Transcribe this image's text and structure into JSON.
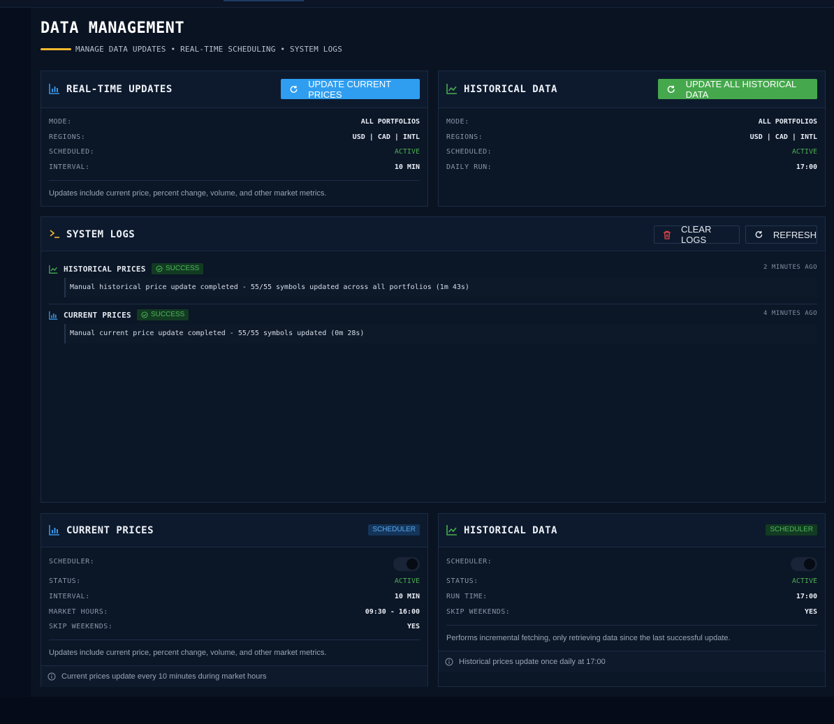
{
  "page": {
    "title": "DATA MANAGEMENT",
    "subtitle": "MANAGE DATA UPDATES • REAL-TIME SCHEDULING • SYSTEM LOGS"
  },
  "colors": {
    "accent_blue": "#2f9ef0",
    "accent_green": "#45a84c",
    "title_underline": "#f5b82e",
    "active_text": "#4caf50"
  },
  "realtime": {
    "title": "REAL-TIME UPDATES",
    "icon": "bar-chart-icon",
    "button_label": "UPDATE CURRENT PRICES",
    "rows": [
      {
        "key": "MODE:",
        "value": "ALL PORTFOLIOS"
      },
      {
        "key": "REGIONS:",
        "value": "USD | CAD | INTL"
      },
      {
        "key": "SCHEDULED:",
        "value": "ACTIVE"
      },
      {
        "key": "INTERVAL:",
        "value": "10 MIN"
      }
    ],
    "note": "Updates include current price, percent change, volume, and other market metrics."
  },
  "historical": {
    "title": "HISTORICAL DATA",
    "icon": "line-chart-icon",
    "button_label": "UPDATE ALL HISTORICAL DATA",
    "rows": [
      {
        "key": "MODE:",
        "value": "ALL PORTFOLIOS"
      },
      {
        "key": "REGIONS:",
        "value": "USD | CAD | INTL"
      },
      {
        "key": "SCHEDULED:",
        "value": "ACTIVE"
      },
      {
        "key": "DAILY RUN:",
        "value": "17:00"
      }
    ]
  },
  "logs": {
    "title": "SYSTEM LOGS",
    "icon": "terminal-icon",
    "clear_label": "CLEAR LOGS",
    "refresh_label": "REFRESH",
    "entries": [
      {
        "title": "HISTORICAL PRICES",
        "status": "SUCCESS",
        "time": "2 MINUTES AGO",
        "message": "Manual historical price update completed - 55/55 symbols updated across all portfolios (1m 43s)"
      },
      {
        "title": "CURRENT PRICES",
        "status": "SUCCESS",
        "time": "4 MINUTES AGO",
        "message": "Manual current price update completed - 55/55 symbols updated (0m 28s)"
      }
    ]
  },
  "current_scheduler": {
    "title": "CURRENT PRICES",
    "badge": "SCHEDULER",
    "toggle_on": true,
    "rows": [
      {
        "key": "SCHEDULER:",
        "value": ""
      },
      {
        "key": "STATUS:",
        "value": "ACTIVE"
      },
      {
        "key": "INTERVAL:",
        "value": "10 MIN"
      },
      {
        "key": "MARKET HOURS:",
        "value": "09:30 - 16:00"
      },
      {
        "key": "SKIP WEEKENDS:",
        "value": "YES"
      }
    ],
    "note": "Updates include current price, percent change, volume, and other market metrics.",
    "info": "Current prices update every 10 minutes during market hours"
  },
  "historical_scheduler": {
    "title": "HISTORICAL DATA",
    "badge": "SCHEDULER",
    "toggle_on": true,
    "rows": [
      {
        "key": "SCHEDULER:",
        "value": ""
      },
      {
        "key": "STATUS:",
        "value": "ACTIVE"
      },
      {
        "key": "RUN TIME:",
        "value": "17:00"
      },
      {
        "key": "SKIP WEEKENDS:",
        "value": "YES"
      }
    ],
    "note": "Performs incremental fetching, only retrieving data since the last successful update.",
    "info": "Historical prices update once daily at 17:00"
  }
}
